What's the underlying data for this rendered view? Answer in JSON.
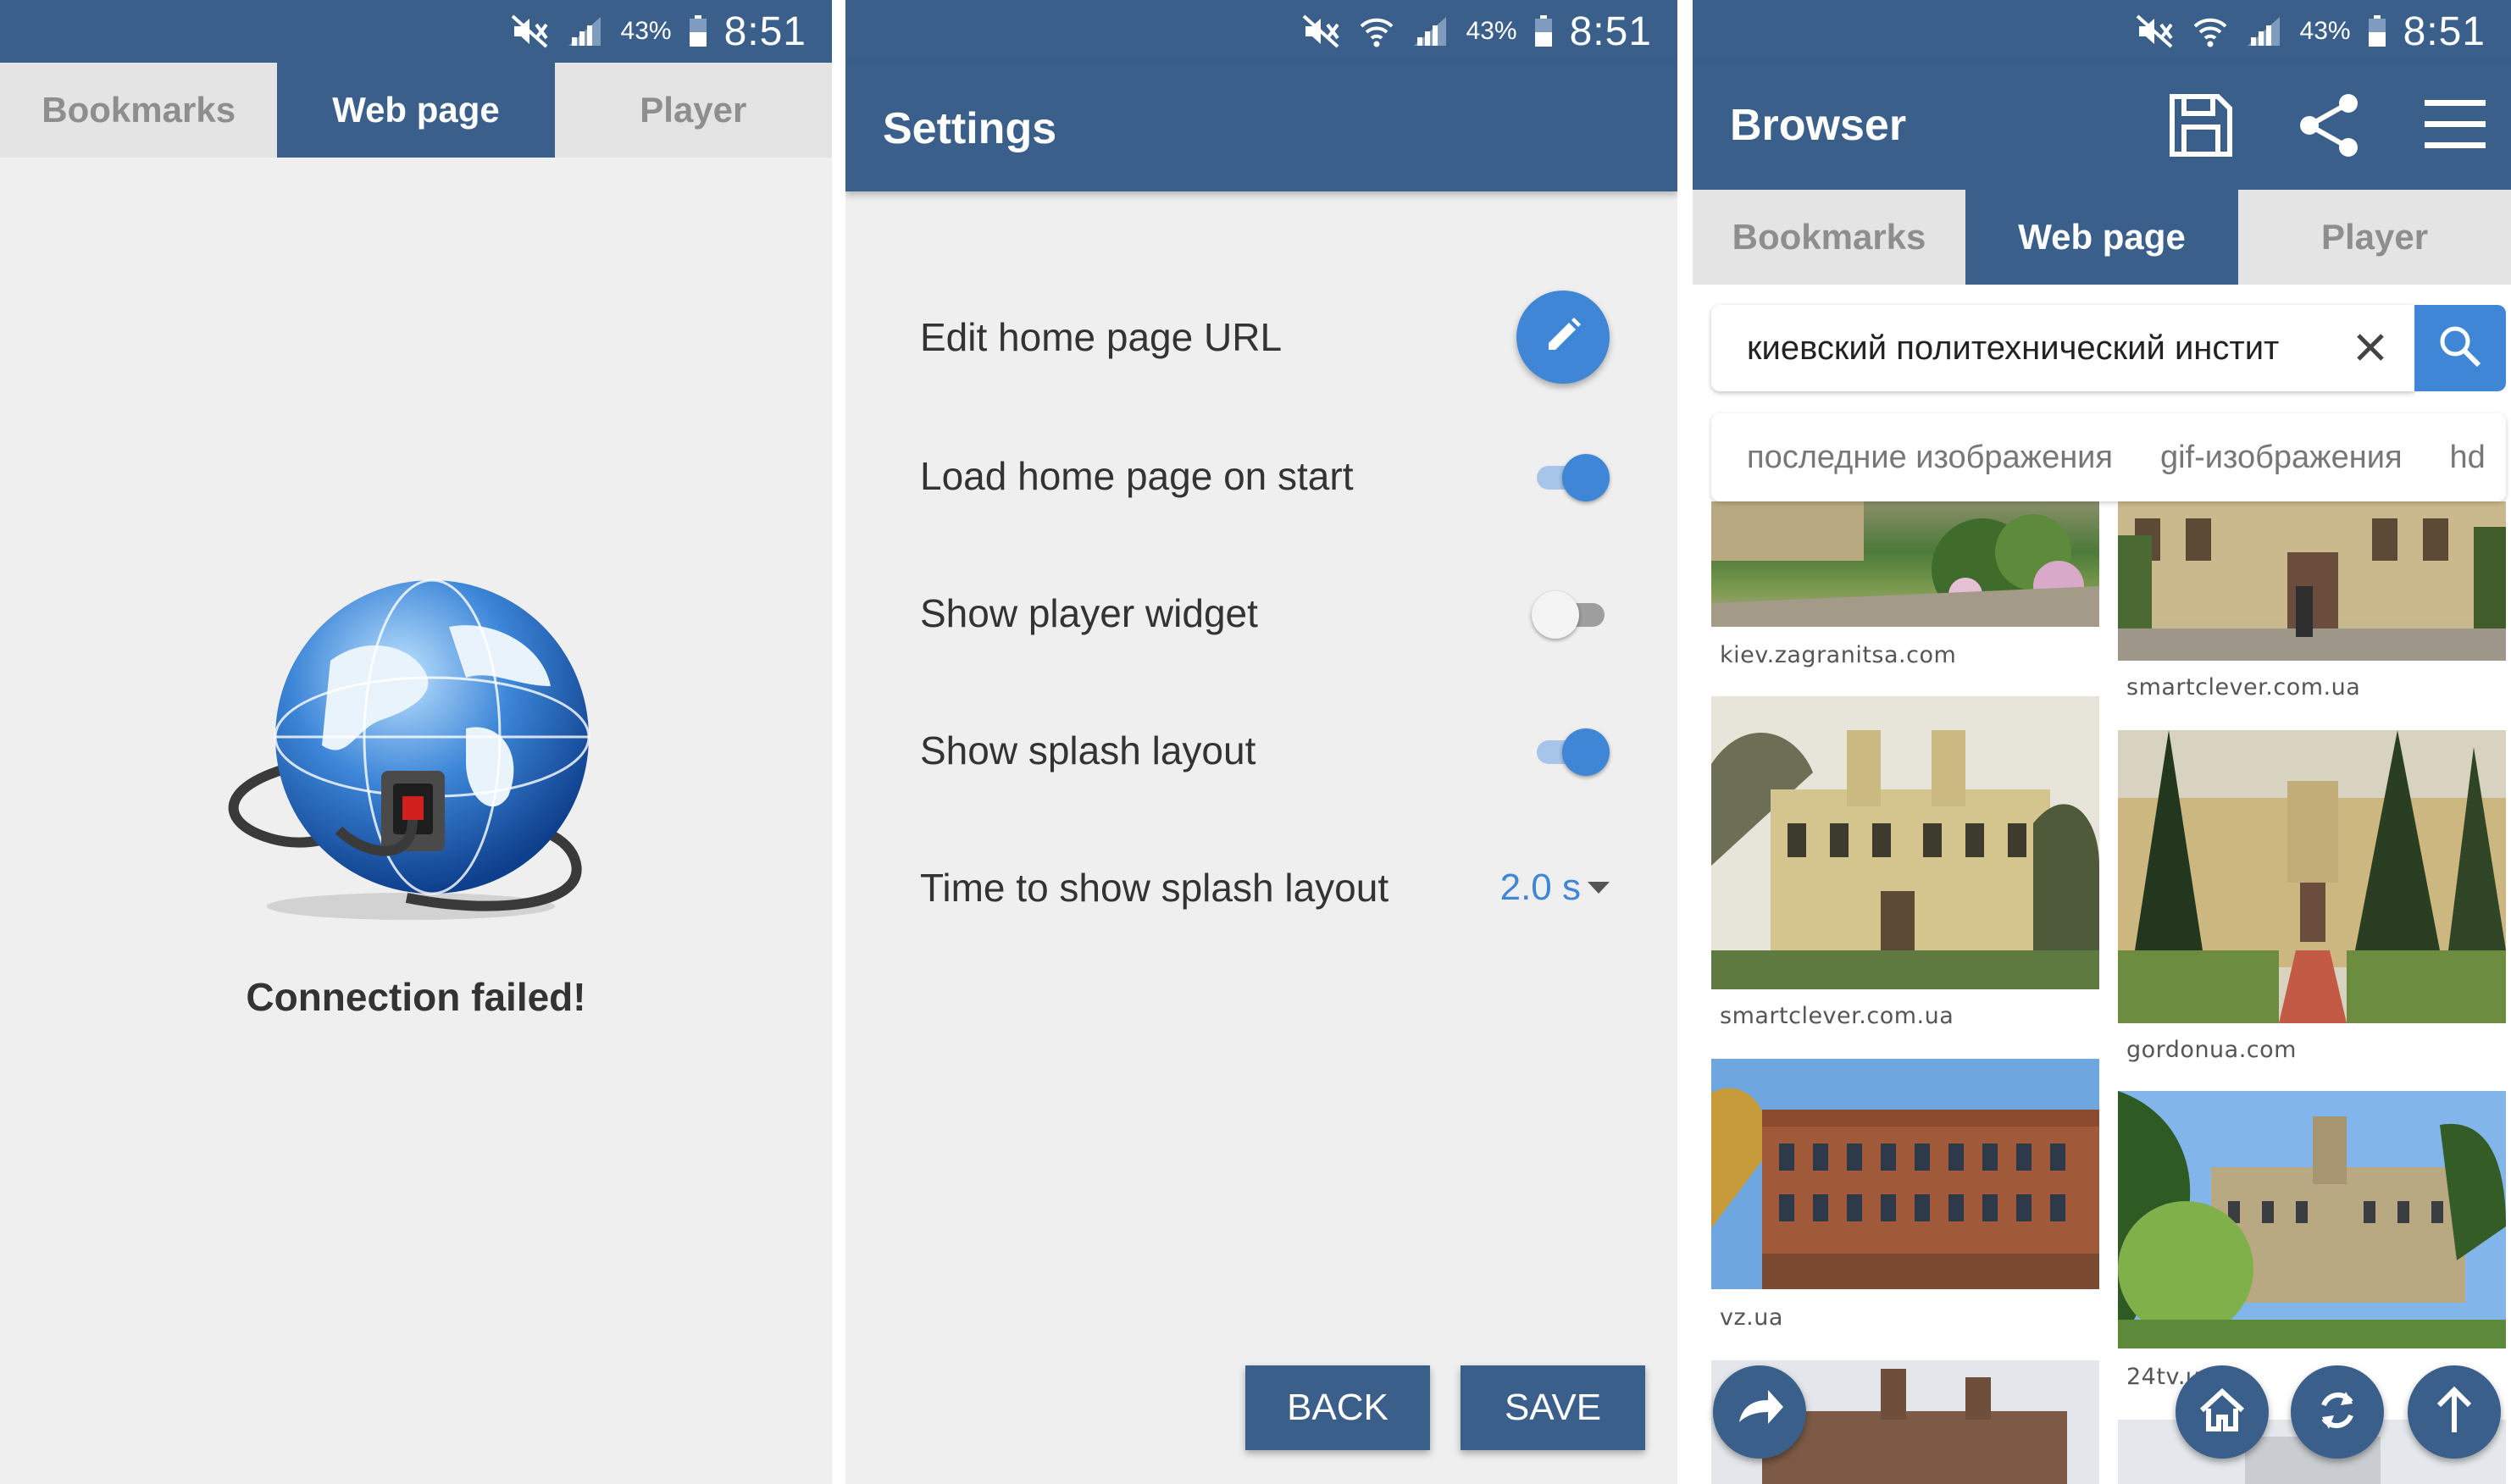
{
  "status": {
    "battery": "43%",
    "time": "8:51"
  },
  "tabs": [
    "Bookmarks",
    "Web page",
    "Player"
  ],
  "panel1": {
    "message": "Connection failed!"
  },
  "panel2": {
    "title": "Settings",
    "settings": [
      {
        "label": "Edit home page URL",
        "control": "edit-button"
      },
      {
        "label": "Load home page on start",
        "control": "toggle",
        "value": true
      },
      {
        "label": "Show player widget",
        "control": "toggle",
        "value": false
      },
      {
        "label": "Show splash layout",
        "control": "toggle",
        "value": true
      },
      {
        "label": "Time to show splash layout",
        "control": "select",
        "value": "2.0 s"
      }
    ],
    "back_label": "BACK",
    "save_label": "SAVE"
  },
  "panel3": {
    "title": "Browser",
    "search_query": "киевский политехнический инстит",
    "suggestions": [
      "последние изображения",
      "gif-изображения",
      "hd"
    ],
    "captions": [
      "kiev.zagranitsa.com",
      "smartclever.com.ua",
      "smartclever.com.ua",
      "gordonua.com",
      "vz.ua",
      "24tv.u"
    ]
  },
  "colors": {
    "primary": "#3a5f8a",
    "accent": "#3f86d6",
    "background": "#efefef"
  }
}
